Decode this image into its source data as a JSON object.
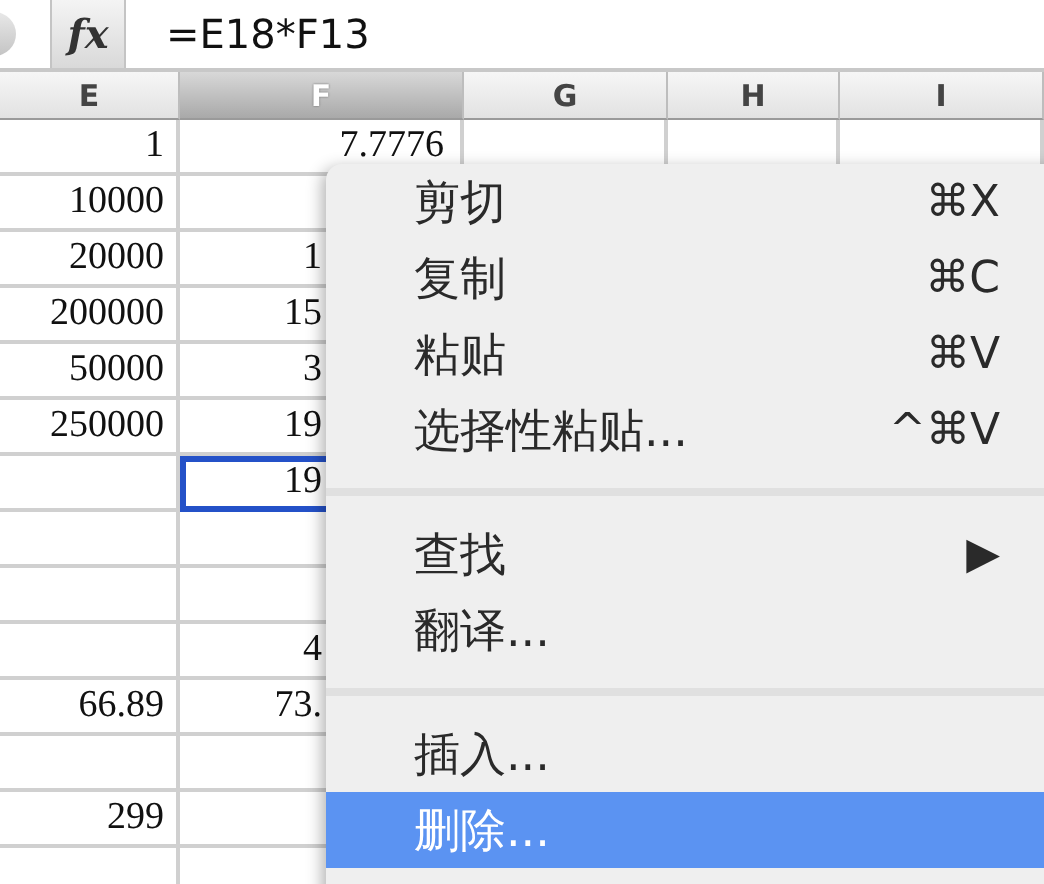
{
  "formula_bar": {
    "function_label": "fx",
    "formula": "=E18*F13"
  },
  "columns": [
    {
      "label": "E",
      "selected": false
    },
    {
      "label": "F",
      "selected": true
    },
    {
      "label": "G",
      "selected": false
    },
    {
      "label": "H",
      "selected": false
    },
    {
      "label": "I",
      "selected": false
    }
  ],
  "rows": [
    {
      "e": "1",
      "f": "7.7776",
      "f_selected": false
    },
    {
      "e": "10000",
      "f": "",
      "f_selected": false
    },
    {
      "e": "20000",
      "f": "1",
      "f_selected": false
    },
    {
      "e": "200000",
      "f": "15",
      "f_selected": false
    },
    {
      "e": "50000",
      "f": "3",
      "f_selected": false
    },
    {
      "e": "250000",
      "f": "19",
      "f_selected": false
    },
    {
      "e": "",
      "f": "19",
      "f_selected": true
    },
    {
      "e": "",
      "f": "",
      "f_selected": false
    },
    {
      "e": "",
      "f": "",
      "f_selected": false
    },
    {
      "e": "",
      "f": "4",
      "f_selected": false
    },
    {
      "e": "66.89",
      "f": "73.",
      "f_selected": false
    },
    {
      "e": "",
      "f": "",
      "f_selected": false
    },
    {
      "e": "299",
      "f": "",
      "f_selected": false
    },
    {
      "e": "",
      "f": "",
      "f_selected": false
    }
  ],
  "context_menu": [
    {
      "kind": "item",
      "label": "剪切",
      "shortcut": "⌘X",
      "selected": false
    },
    {
      "kind": "item",
      "label": "复制",
      "shortcut": "⌘C",
      "selected": false
    },
    {
      "kind": "item",
      "label": "粘贴",
      "shortcut": "⌘V",
      "selected": false
    },
    {
      "kind": "item",
      "label": "选择性粘贴...",
      "shortcut": "^⌘V",
      "selected": false
    },
    {
      "kind": "separator"
    },
    {
      "kind": "item",
      "label": "查找",
      "shortcut": "▶",
      "selected": false
    },
    {
      "kind": "item",
      "label": "翻译...",
      "selected": false
    },
    {
      "kind": "separator"
    },
    {
      "kind": "item",
      "label": "插入...",
      "selected": false
    },
    {
      "kind": "item",
      "label": "删除...",
      "selected": true
    }
  ]
}
